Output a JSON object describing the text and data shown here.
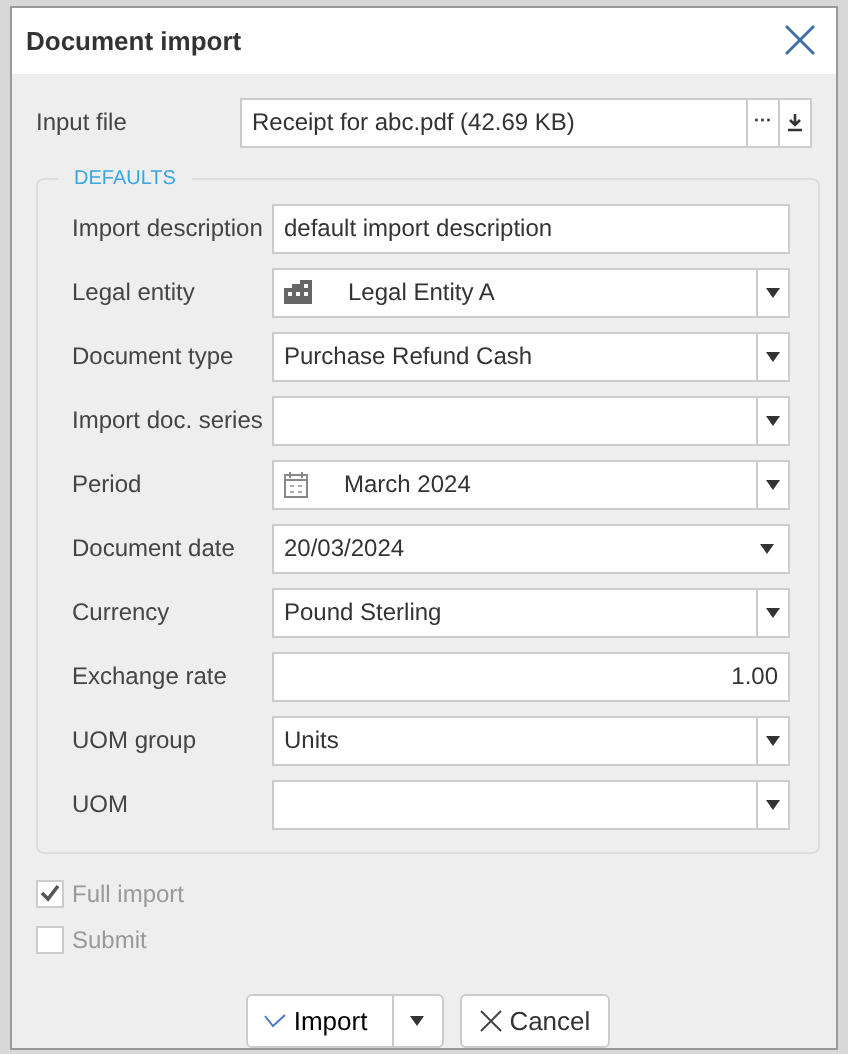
{
  "dialog": {
    "title": "Document import"
  },
  "input_file": {
    "label": "Input file",
    "value": "Receipt for abc.pdf (42.69 KB)",
    "browse": "···"
  },
  "defaults": {
    "legend": "DEFAULTS",
    "fields": [
      {
        "label": "Import description",
        "kind": "text",
        "value": "default import description"
      },
      {
        "label": "Legal entity",
        "kind": "entity",
        "value": "Legal Entity A"
      },
      {
        "label": "Document type",
        "kind": "select",
        "value": "Purchase Refund Cash"
      },
      {
        "label": "Import doc. series",
        "kind": "select"
      },
      {
        "label": "Period",
        "kind": "period",
        "value": "March 2024"
      },
      {
        "label": "Document date",
        "kind": "date",
        "value": "20/03/2024"
      },
      {
        "label": "Currency",
        "kind": "select",
        "value": "Pound Sterling"
      },
      {
        "label": "Exchange rate",
        "kind": "number",
        "value": "1.00"
      },
      {
        "label": "UOM group",
        "kind": "select",
        "value": "Units"
      },
      {
        "label": "UOM",
        "kind": "select"
      }
    ]
  },
  "options": [
    {
      "label": "Full import",
      "checked": true,
      "disabled": true
    },
    {
      "label": "Submit",
      "checked": false,
      "disabled": true
    }
  ],
  "buttons": {
    "import": "Import",
    "cancel": "Cancel"
  }
}
